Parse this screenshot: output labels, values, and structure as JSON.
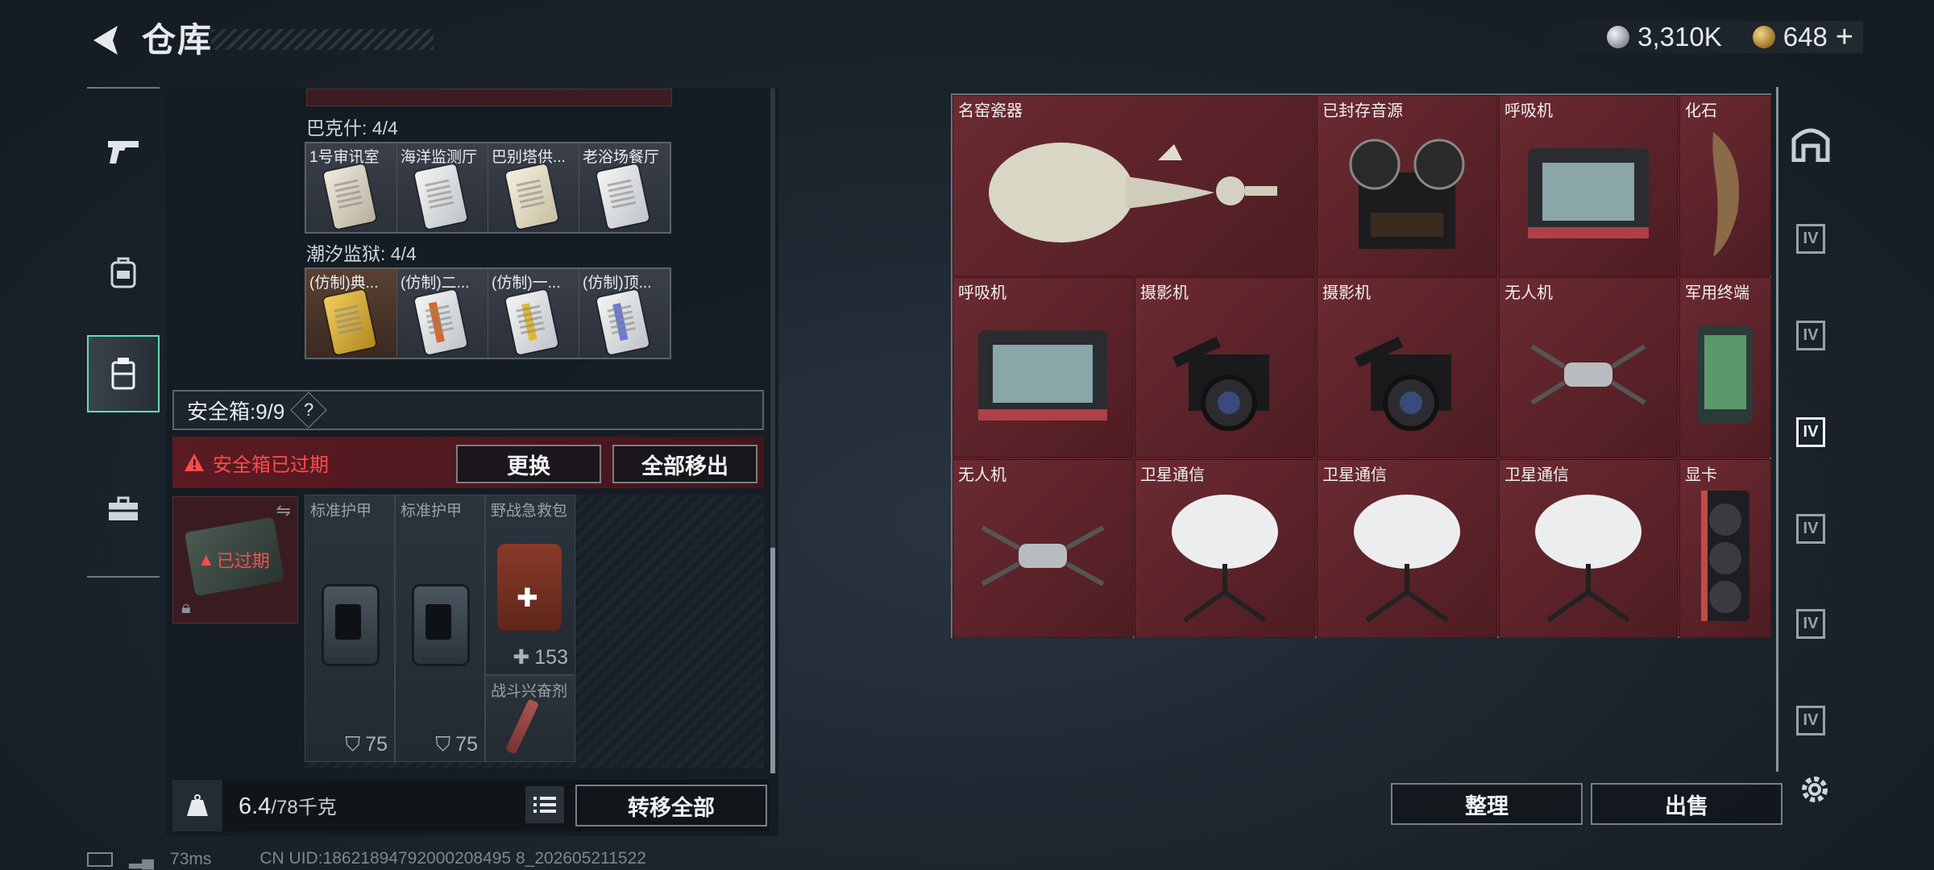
{
  "header": {
    "title": "仓库",
    "currency_silver": "3,310K",
    "currency_gold": "648",
    "gold_plus": "+"
  },
  "left_nav": {
    "items": [
      "weapon-icon",
      "backpack-icon",
      "vest-icon",
      "case-icon"
    ],
    "active_index": 2
  },
  "keycards": {
    "group1": {
      "label": "巴克什: 4/4",
      "cards": [
        "1号审讯室",
        "海洋监测厅",
        "巴别塔供...",
        "老浴场餐厅"
      ]
    },
    "group2": {
      "label": "潮汐监狱: 4/4",
      "cards": [
        "(仿制)典...",
        "(仿制)二...",
        "(仿制)一...",
        "(仿制)顶..."
      ]
    }
  },
  "safebox": {
    "label": "安全箱:9/9",
    "help": "?",
    "expired_warning": "安全箱已过期",
    "replace_button": "更换",
    "move_all_out_button": "全部移出",
    "box_status": "已过期"
  },
  "safebox_items": [
    {
      "name": "标准护甲",
      "value": "75"
    },
    {
      "name": "标准护甲",
      "value": "75"
    },
    {
      "name": "野战急救包",
      "value": "153"
    },
    {
      "name": "战斗兴奋剂"
    }
  ],
  "weight": {
    "current": "6.4",
    "max": "/78千克"
  },
  "transfer_all_button": "转移全部",
  "status_bar": {
    "ping": "73ms",
    "uid": "CN UID:18621894792000208495 8_202605211522"
  },
  "stash_items": [
    {
      "name": "名窑瓷器"
    },
    {
      "name": "已封存音源"
    },
    {
      "name": "呼吸机"
    },
    {
      "name": "化石"
    },
    {
      "name": "呼吸机"
    },
    {
      "name": "摄影机"
    },
    {
      "name": "摄影机"
    },
    {
      "name": "无人机"
    },
    {
      "name": "军用终端"
    },
    {
      "name": "无人机"
    },
    {
      "name": "卫星通信"
    },
    {
      "name": "卫星通信"
    },
    {
      "name": "卫星通信"
    },
    {
      "name": "显卡"
    }
  ],
  "right_actions": {
    "sort_button": "整理",
    "sell_button": "出售"
  },
  "colors": {
    "accent": "#5fe0b0",
    "warning": "#ff4a4a",
    "cell_bg": "#5c2329"
  }
}
